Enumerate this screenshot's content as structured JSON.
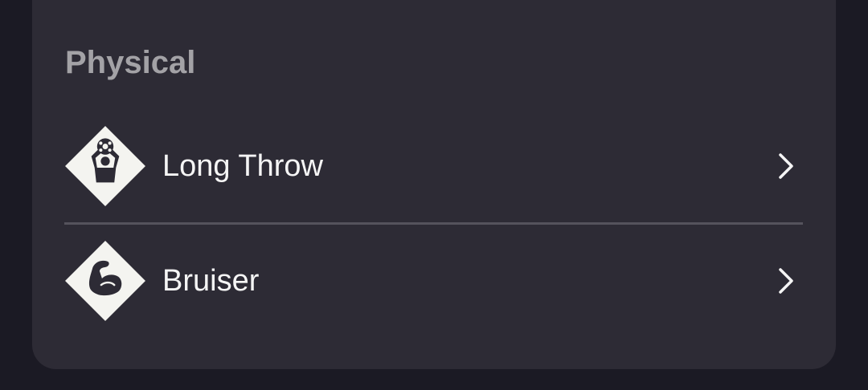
{
  "section": {
    "title": "Physical"
  },
  "traits": [
    {
      "label": "Long Throw",
      "icon": "long-throw-icon"
    },
    {
      "label": "Bruiser",
      "icon": "bruiser-icon"
    }
  ],
  "colors": {
    "page_bg": "#1b1a24",
    "card_bg": "#2d2b35",
    "section_title": "#a3a2a6",
    "text": "#f5f5f5",
    "divider": "#55535c"
  }
}
